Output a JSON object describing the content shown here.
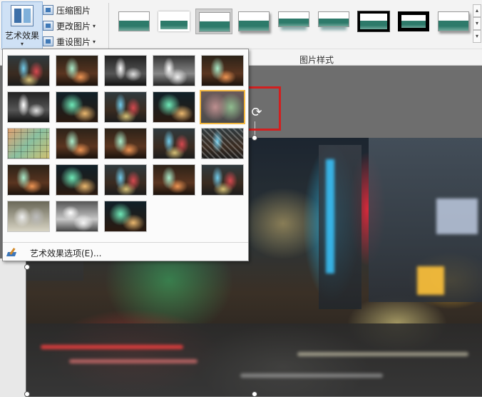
{
  "ribbon": {
    "art_effects_label": "艺术效果",
    "art_effects_arrow": "▾",
    "commands": [
      {
        "label": "压缩图片",
        "has_dropdown": false
      },
      {
        "label": "更改图片",
        "has_dropdown": true
      },
      {
        "label": "重设图片",
        "has_dropdown": true
      }
    ],
    "dropdown_glyph": "▾",
    "styles_group_label": "图片样式",
    "scroll_up": "▴",
    "scroll_down": "▾",
    "scroll_more": "▾"
  },
  "gallery": {
    "options_label": "艺术效果选项(E)...",
    "selected_index": 10
  },
  "canvas": {
    "rotate_glyph": "⟳"
  },
  "colors": {
    "highlight_border": "#d21f1f",
    "selected_thumb_border": "#f1b640",
    "ribbon_bg": "#f3f3f3"
  },
  "icons": [
    "art-effects-icon",
    "compress-pictures-icon",
    "change-picture-icon",
    "reset-picture-icon",
    "art-effects-options-icon",
    "rotate-handle-icon"
  ]
}
